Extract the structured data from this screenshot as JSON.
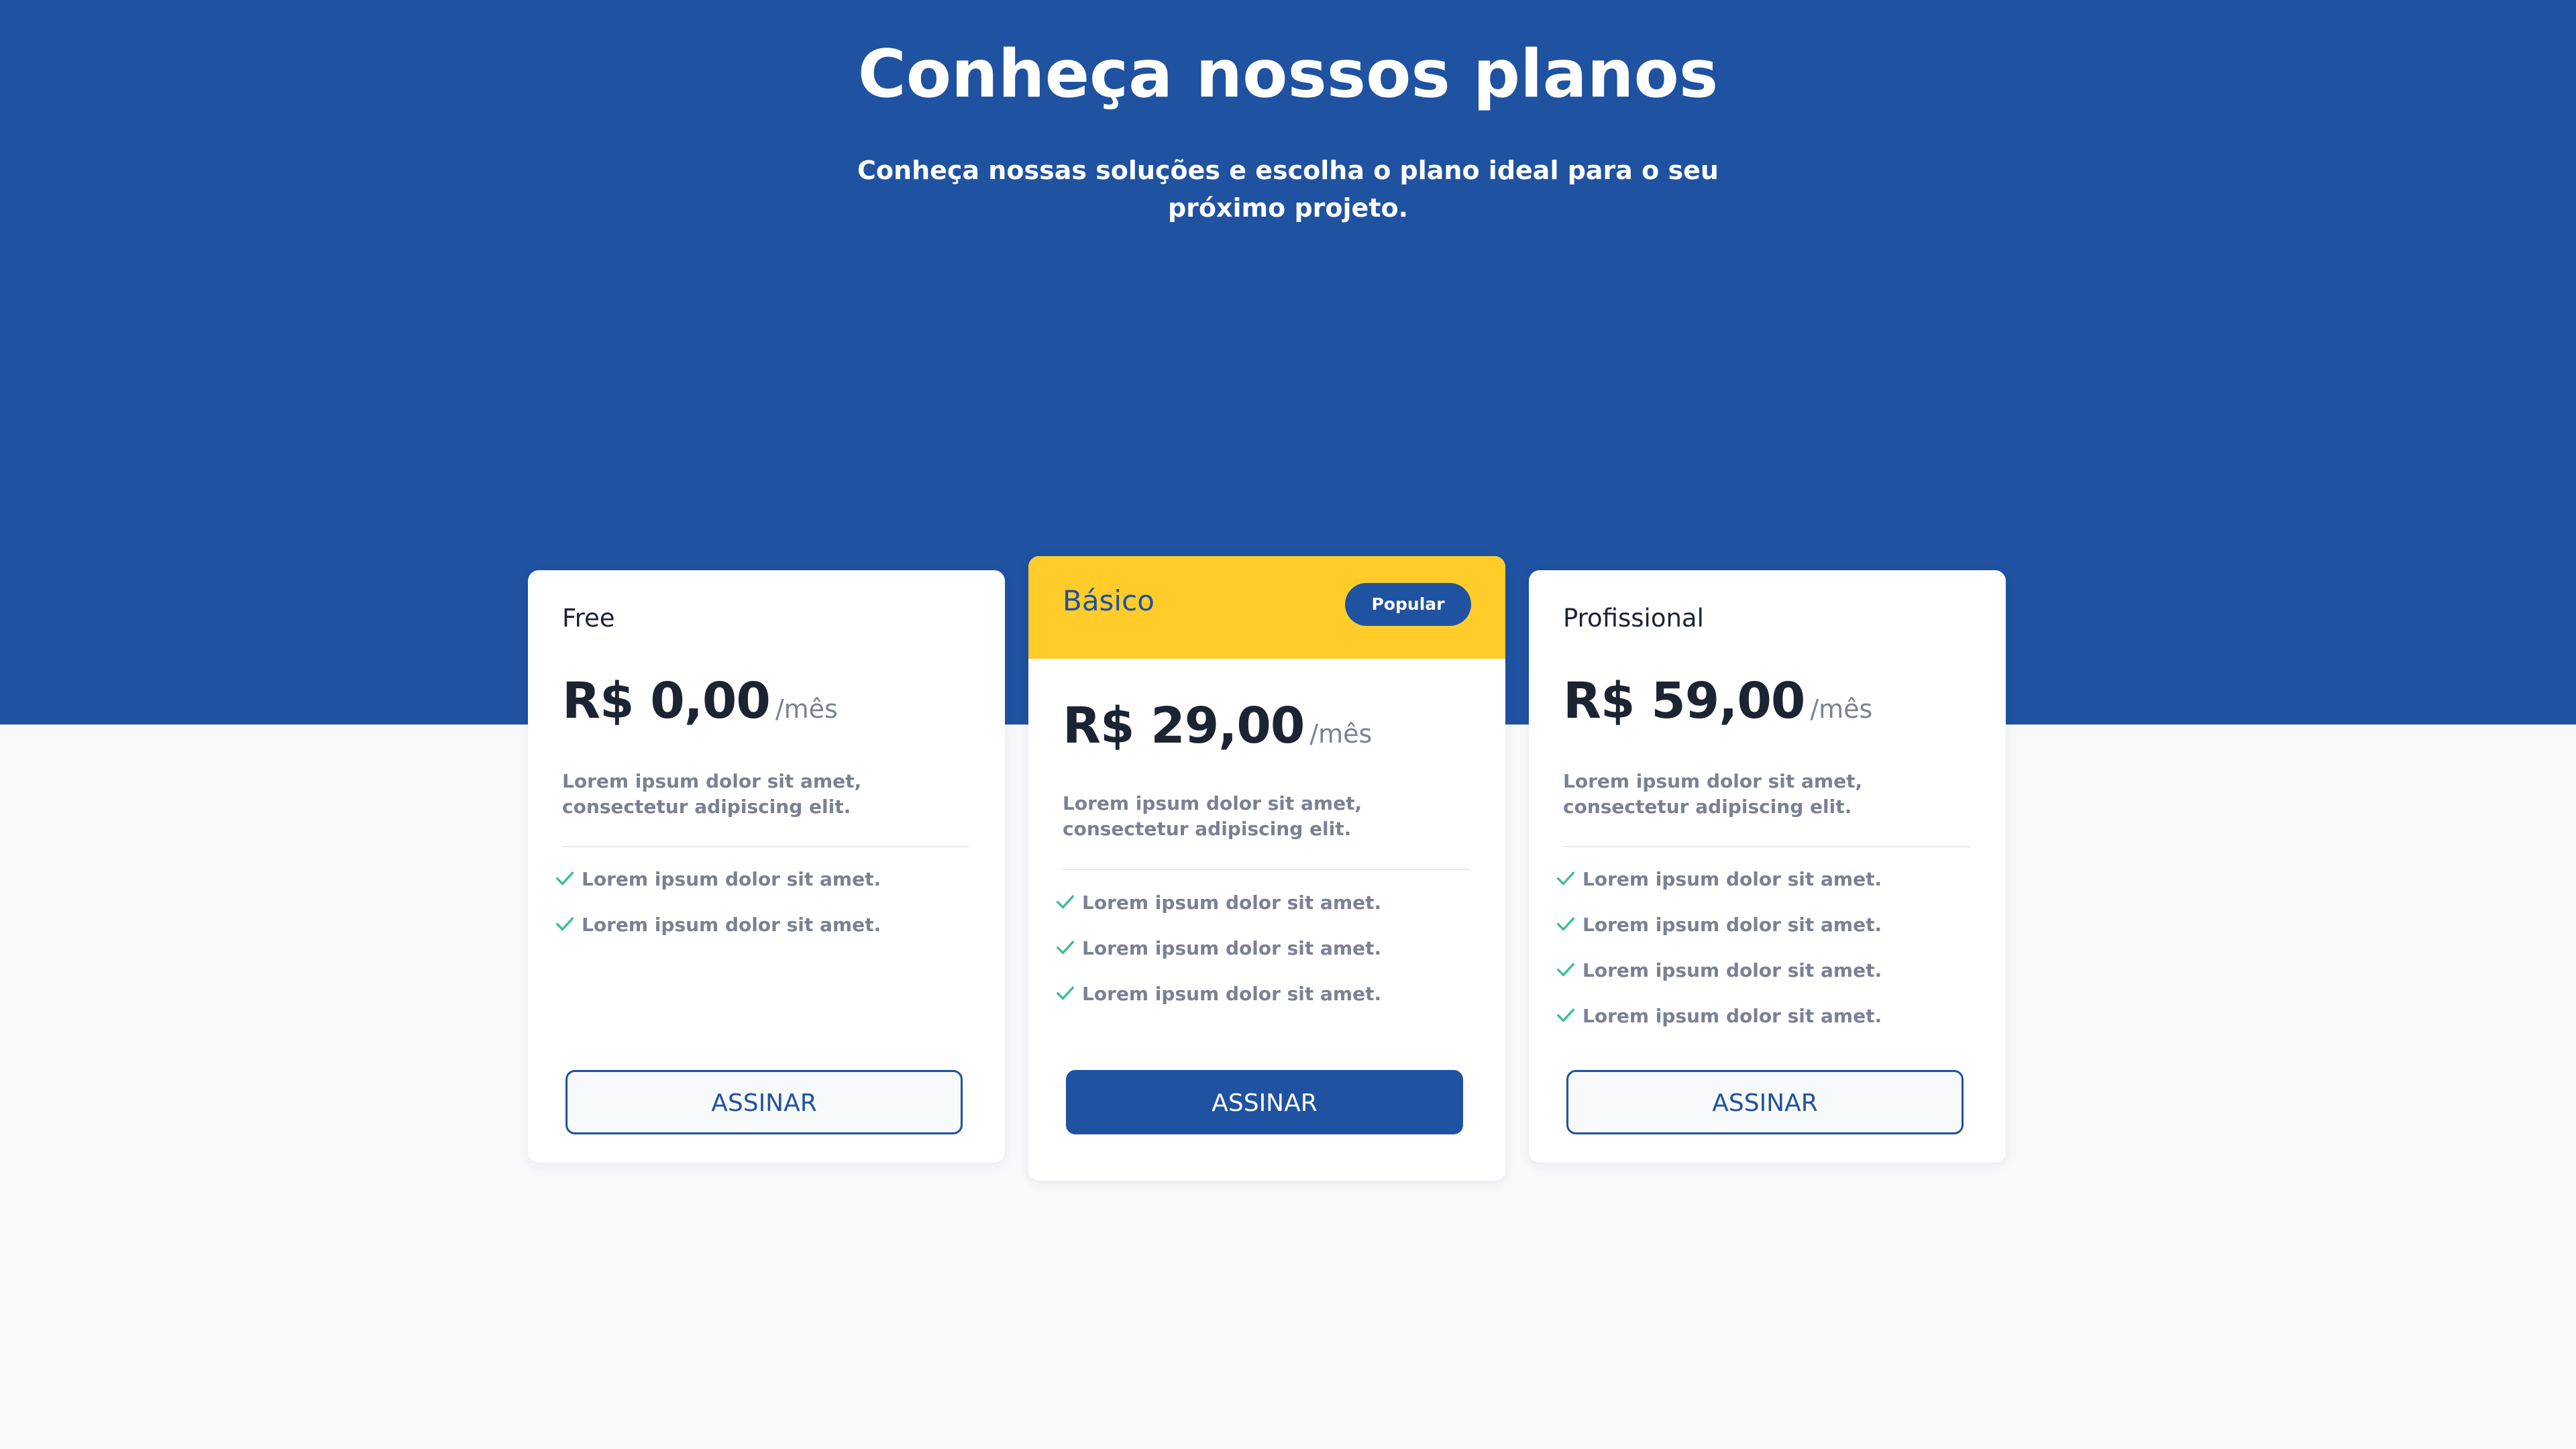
{
  "hero": {
    "title": "Conheça nossos planos",
    "subtitle": "Conheça nossas soluções e escolha o plano ideal para o seu próximo projeto."
  },
  "colors": {
    "brand_blue": "#1f52a0",
    "highlight_yellow": "#ffcc29",
    "check_green": "#3cbf93",
    "background": "#f8f9fb"
  },
  "plans": [
    {
      "name": "Free",
      "price": "R$ 0,00",
      "period": "/mês",
      "description": "Lorem ipsum dolor sit amet, consectetur adipiscing elit.",
      "features": [
        "Lorem ipsum dolor sit amet.",
        "Lorem ipsum dolor sit amet."
      ],
      "button_label": "ASSINAR"
    },
    {
      "name": "Básico",
      "badge": "Popular",
      "price": "R$ 29,00",
      "period": "/mês",
      "description": "Lorem ipsum dolor sit amet, consectetur adipiscing elit.",
      "features": [
        "Lorem ipsum dolor sit amet.",
        "Lorem ipsum dolor sit amet.",
        "Lorem ipsum dolor sit amet."
      ],
      "button_label": "ASSINAR"
    },
    {
      "name": "Profissional",
      "price": "R$ 59,00",
      "period": "/mês",
      "description": "Lorem ipsum dolor sit amet, consectetur adipiscing elit.",
      "features": [
        "Lorem ipsum dolor sit amet.",
        "Lorem ipsum dolor sit amet.",
        "Lorem ipsum dolor sit amet.",
        "Lorem ipsum dolor sit amet."
      ],
      "button_label": "ASSINAR"
    }
  ]
}
